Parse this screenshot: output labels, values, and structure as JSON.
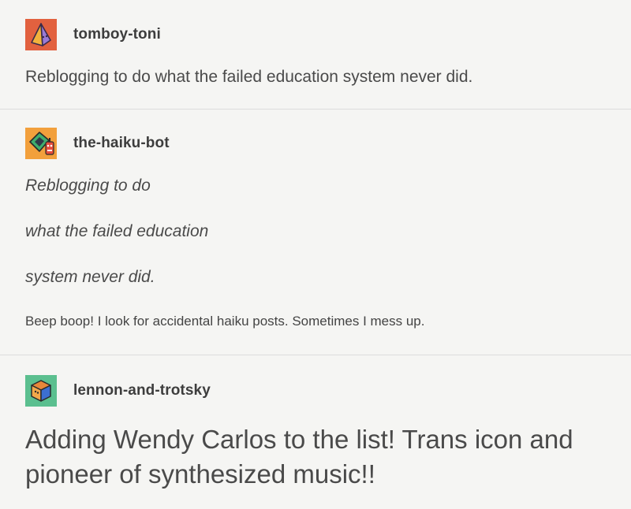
{
  "posts": [
    {
      "username": "tomboy-toni",
      "avatar_icon": "orange-pyramid-avatar-icon",
      "body": "Reblogging to do what the failed education system never did."
    },
    {
      "username": "the-haiku-bot",
      "avatar_icon": "robot-bot-avatar-icon",
      "haiku_lines": [
        "Reblogging to do",
        "what the failed education",
        "system never did."
      ],
      "footer": "Beep boop! I look for accidental haiku posts. Sometimes I mess up."
    },
    {
      "username": "lennon-and-trotsky",
      "avatar_icon": "green-cube-avatar-icon",
      "body": "Adding Wendy Carlos to the list! Trans icon and pioneer of synthesized music!!"
    }
  ],
  "colors": {
    "background": "#f5f5f3",
    "divider": "#dcdcdc",
    "avatar1_bg": "#e2613f",
    "avatar2_bg": "#f2a03c",
    "avatar3_bg": "#5bbf8f"
  }
}
